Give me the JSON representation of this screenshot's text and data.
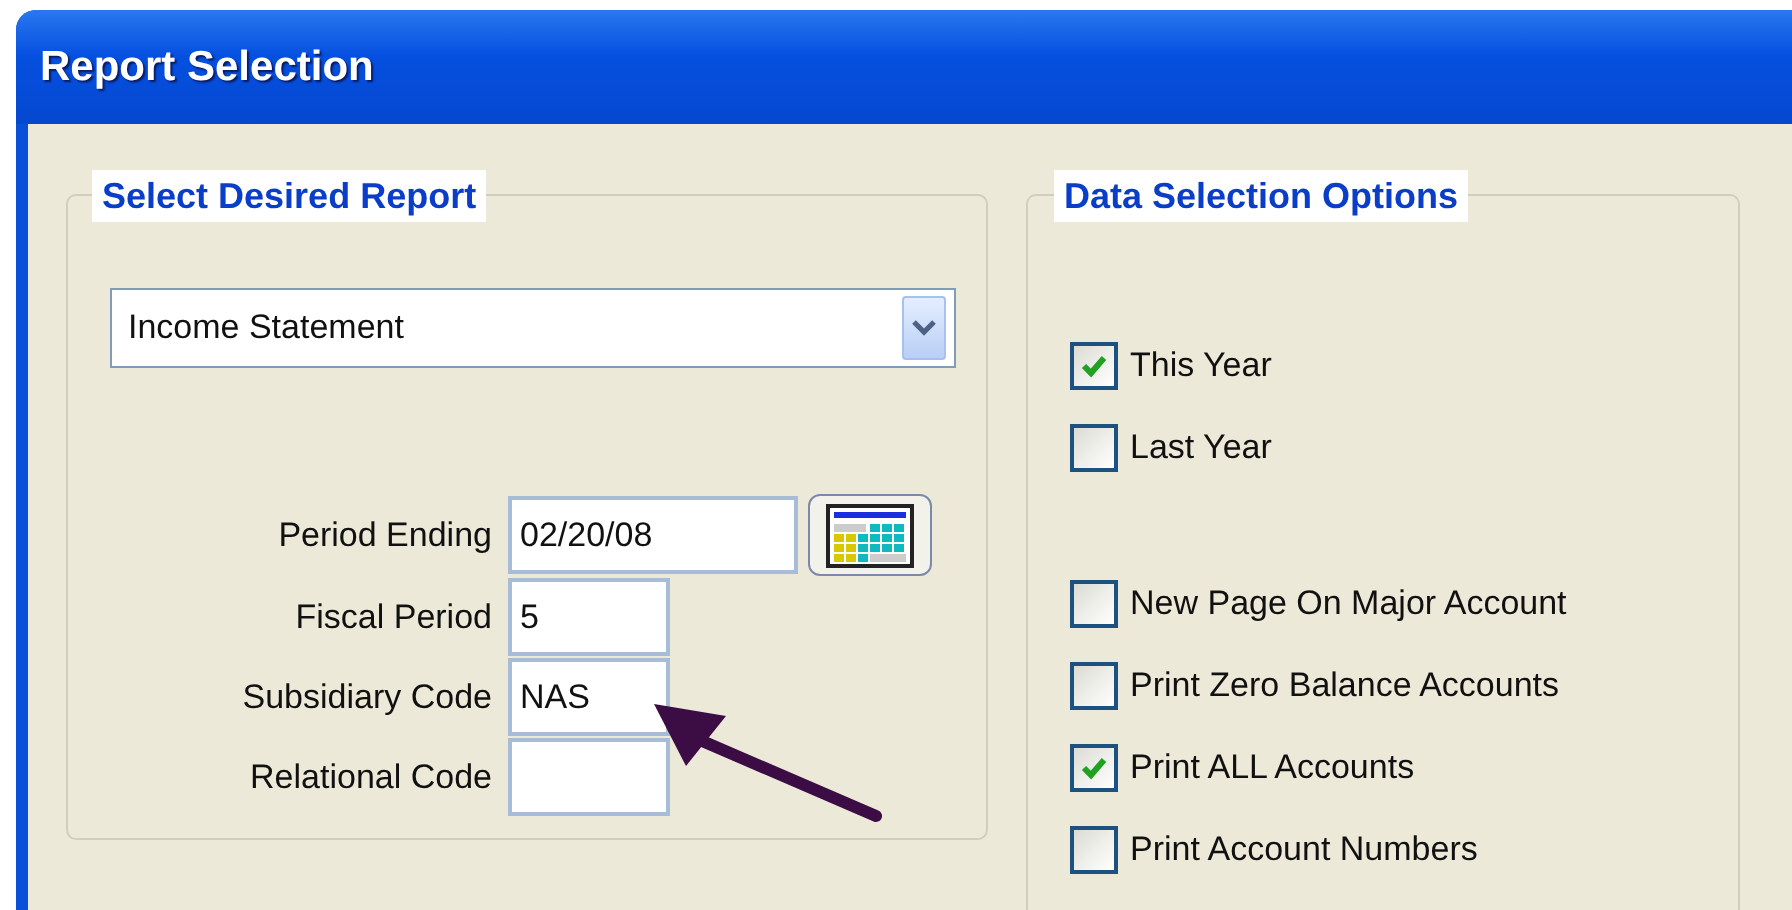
{
  "window": {
    "title": "Report Selection"
  },
  "report_group": {
    "title": "Select Desired Report",
    "report_dropdown": {
      "value": "Income Statement"
    },
    "fields": [
      {
        "label": "Period Ending",
        "value": "02/20/08",
        "kind": "date"
      },
      {
        "label": "Fiscal Period",
        "value": "5",
        "kind": "text"
      },
      {
        "label": "Subsidiary Code",
        "value": "NAS",
        "kind": "text"
      },
      {
        "label": "Relational Code",
        "kind": "text"
      }
    ]
  },
  "options_group": {
    "title": "Data Selection Options",
    "year_options": [
      {
        "label": "This Year",
        "checked": true
      },
      {
        "label": "Last Year",
        "checked": false
      }
    ],
    "print_options": [
      {
        "label": "New Page On Major Account",
        "checked": false
      },
      {
        "label": "Print Zero Balance Accounts",
        "checked": false
      },
      {
        "label": "Print ALL Accounts",
        "checked": true
      },
      {
        "label": "Print Account Numbers",
        "checked": false
      }
    ]
  }
}
